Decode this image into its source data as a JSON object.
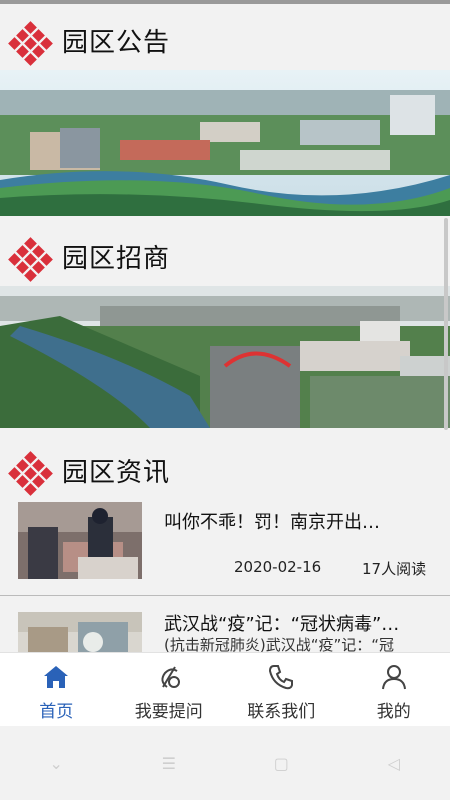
{
  "sections": {
    "announcement": {
      "title": "园区公告"
    },
    "investment": {
      "title": "园区招商"
    },
    "news": {
      "title": "园区资讯"
    }
  },
  "news_list": [
    {
      "title": "叫你不乖！罚！南京开出…",
      "date": "2020-02-16",
      "reads": "17人阅读"
    },
    {
      "title": "武汉战“疫”记：“冠状病毒”…",
      "subtitle": "(抗击新冠肺炎)武汉战“疫”记：“冠"
    }
  ],
  "tabbar": {
    "items": [
      {
        "label": "首页",
        "icon": "home-icon",
        "active": true
      },
      {
        "label": "我要提问",
        "icon": "question-icon",
        "active": false
      },
      {
        "label": "联系我们",
        "icon": "phone-icon",
        "active": false
      },
      {
        "label": "我的",
        "icon": "user-icon",
        "active": false
      }
    ]
  },
  "colors": {
    "accent": "#2a62b8",
    "logo": "#d9303b"
  },
  "system_nav": {
    "icons": [
      "chevron-down-icon",
      "menu-icon",
      "home-square-icon",
      "back-triangle-icon"
    ]
  }
}
